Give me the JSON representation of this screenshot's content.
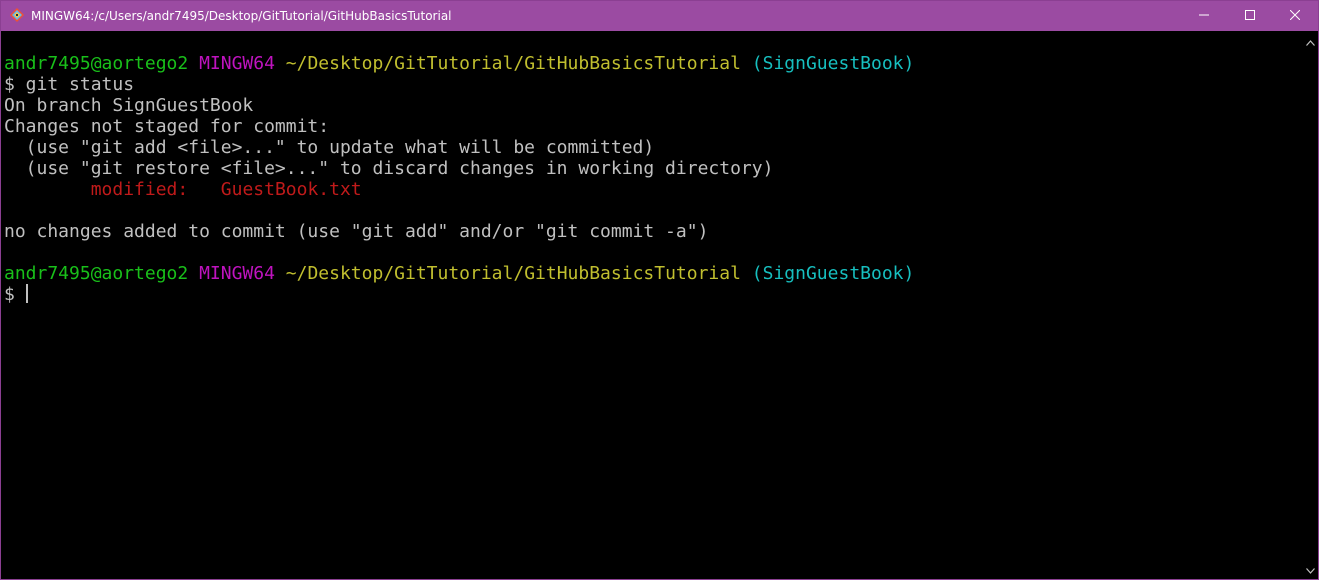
{
  "window": {
    "title": "MINGW64:/c/Users/andr7495/Desktop/GitTutorial/GitHubBasicsTutorial"
  },
  "colors": {
    "titlebar": "#9b4ba2",
    "prompt_user": "#19c01a",
    "prompt_system": "#bf13bf",
    "prompt_path": "#c1bf2f",
    "prompt_branch": "#17bfbf",
    "modified": "#c01a1a",
    "text": "#c0c0c0"
  },
  "terminal": {
    "prompt1": {
      "user": "andr7495@aortego2",
      "system": "MINGW64",
      "path": "~/Desktop/GitTutorial/GitHubBasicsTutorial",
      "branch": "(SignGuestBook)"
    },
    "command": "$ git status",
    "output": [
      "On branch SignGuestBook",
      "Changes not staged for commit:",
      "  (use \"git add <file>...\" to update what will be committed)",
      "  (use \"git restore <file>...\" to discard changes in working directory)"
    ],
    "modified_label": "modified:",
    "modified_file": "GuestBook.txt",
    "summary": "no changes added to commit (use \"git add\" and/or \"git commit -a\")",
    "prompt2": {
      "user": "andr7495@aortego2",
      "system": "MINGW64",
      "path": "~/Desktop/GitTutorial/GitHubBasicsTutorial",
      "branch": "(SignGuestBook)"
    },
    "input_prompt": "$ "
  },
  "icons": {
    "app": "git-bash-icon",
    "minimize": "minimize-icon",
    "maximize": "maximize-icon",
    "close": "close-icon",
    "scroll_up": "scroll-up-arrow-icon",
    "scroll_down": "scroll-down-arrow-icon"
  }
}
